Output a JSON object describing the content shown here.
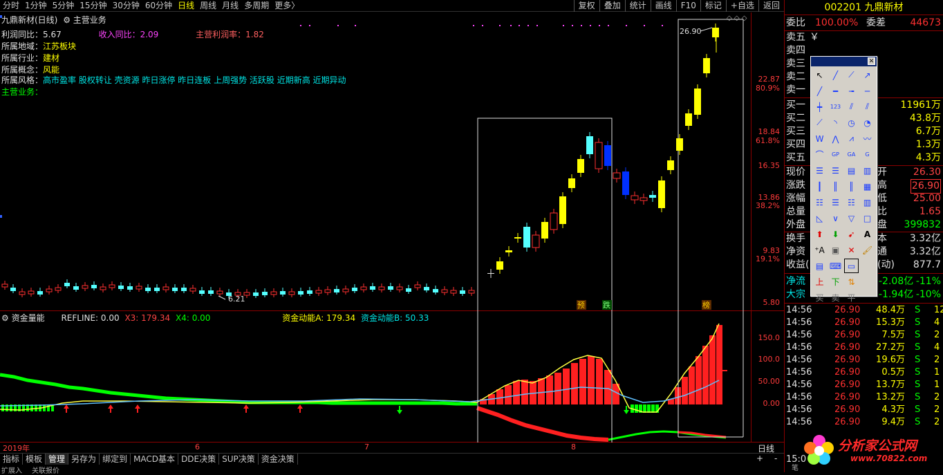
{
  "toolbar": {
    "periods": [
      "分时",
      "1分钟",
      "5分钟",
      "15分钟",
      "30分钟",
      "60分钟",
      "日线",
      "周线",
      "月线",
      "多周期",
      "更多〉"
    ],
    "active_period": "日线",
    "right_buttons": [
      "复权",
      "叠加",
      "统计",
      "画线",
      "F10",
      "标记",
      "+自选",
      "返回"
    ]
  },
  "main_chart": {
    "title": "九鼎新材(日线)",
    "indicator": "主营业务",
    "info": {
      "profit_yoy_label": "利润同比：",
      "profit_yoy": "5.67",
      "revenue_yoy_label": "收入同比：",
      "revenue_yoy": "2.09",
      "main_margin_label": "主营利润率：",
      "main_margin": "1.82",
      "region_label": "所属地域：",
      "region": "江苏板块",
      "industry_label": "所属行业：",
      "industry": "建材",
      "concept_label": "所属概念：",
      "concept": "风能",
      "style_label": "所属风格：",
      "style": "高市盈率 股权转让 壳资源 昨日涨停 昨日连板 上周强势 活跃股 近期新高 近期异动",
      "business_label": "主营业务："
    },
    "y_labels": [
      {
        "price": "22.87",
        "pct": "80.9%"
      },
      {
        "price": "18.84",
        "pct": "61.8%"
      },
      {
        "price": "16.35",
        "pct": ""
      },
      {
        "price": "13.86",
        "pct": "38.2%"
      },
      {
        "price": "9.83",
        "pct": "19.1%"
      },
      {
        "price": "5.80",
        "pct": ""
      }
    ],
    "high_label": "26.90",
    "low_label": "6.21",
    "signals": [
      "预",
      "跌",
      "榜"
    ]
  },
  "sub_chart": {
    "title": "资金量能",
    "refline_label": "REFLINE: 0.00",
    "x3_label": "X3: 179.34",
    "x4_label": "X4: 0.00",
    "a_label": "资金动能A: 179.34",
    "b_label": "资金动能B: 50.33",
    "y_labels": [
      "150.0",
      "100.0",
      "50.00",
      "0.00"
    ]
  },
  "x_axis": {
    "labels": [
      "2019年",
      "6",
      "7",
      "8"
    ],
    "right_label": "日线"
  },
  "bottom_tabs": [
    "指标",
    "模板",
    "管理",
    "另存为",
    "绑定到",
    "MACD基本",
    "DDE决策",
    "SUP决策",
    "资金决策"
  ],
  "active_tab": "管理",
  "statusbar": {
    "left": "扩展入",
    "mid": "关联报价"
  },
  "right_panel": {
    "code": "002201",
    "name": "九鼎新材",
    "weibi_label": "委比",
    "weibi": "100.00%",
    "weicha_label": "委差",
    "weicha": "44673",
    "sell_labels": [
      "卖五",
      "卖四",
      "卖三",
      "卖二",
      "卖一"
    ],
    "sell5_extra": "￥",
    "buy_labels": [
      "买一",
      "买二",
      "买三",
      "买四",
      "买五"
    ],
    "buy_vols": [
      "11961万",
      "43.8万",
      "6.7万",
      "1.3万",
      "4.3万"
    ],
    "stats": [
      {
        "l": "现价",
        "r_label": "开",
        "r_val": "26.30"
      },
      {
        "l": "涨跌",
        "r_label": "高",
        "r_val": "26.90"
      },
      {
        "l": "涨幅",
        "r_label": "低",
        "r_val": "25.00"
      },
      {
        "l": "总量",
        "r_label": "比",
        "r_val": "1.65"
      },
      {
        "l": "外盘",
        "r_label": "盘",
        "r_val": "399832"
      },
      {
        "l": "换手",
        "r_label": "本",
        "r_val": "3.32亿"
      },
      {
        "l": "净资",
        "r_label": "通",
        "r_val": "3.32亿"
      },
      {
        "l": "收益(",
        "r_label": "(动)",
        "r_val": "877.7"
      }
    ],
    "flow": [
      {
        "l": "净流",
        "v1": "-2.08亿",
        "v2": "-11%"
      },
      {
        "l": "大宗",
        "v1": "-1.94亿",
        "v2": "-10%"
      }
    ],
    "trades": [
      {
        "t": "14:56",
        "p": "26.90",
        "v": "48.4万",
        "s": "S",
        "n": "12"
      },
      {
        "t": "14:56",
        "p": "26.90",
        "v": "15.3万",
        "s": "S",
        "n": "4"
      },
      {
        "t": "14:56",
        "p": "26.90",
        "v": "7.5万",
        "s": "S",
        "n": "2"
      },
      {
        "t": "14:56",
        "p": "26.90",
        "v": "27.2万",
        "s": "S",
        "n": "4"
      },
      {
        "t": "14:56",
        "p": "26.90",
        "v": "19.6万",
        "s": "S",
        "n": "2"
      },
      {
        "t": "14:56",
        "p": "26.90",
        "v": "0.5万",
        "s": "S",
        "n": "1"
      },
      {
        "t": "14:56",
        "p": "26.90",
        "v": "13.7万",
        "s": "S",
        "n": "1"
      },
      {
        "t": "14:56",
        "p": "26.90",
        "v": "13.2万",
        "s": "S",
        "n": "2"
      },
      {
        "t": "14:56",
        "p": "26.90",
        "v": "4.3万",
        "s": "S",
        "n": "2"
      },
      {
        "t": "14:56",
        "p": "26.90",
        "v": "9.4万",
        "s": "S",
        "n": "2"
      }
    ],
    "last_trade_time": "15:0",
    "footer_label": "笔"
  },
  "palette": {
    "bottom_labels": [
      "买",
      "卖",
      "平"
    ]
  },
  "logo": {
    "text": "分析家公式网",
    "url": "www.70822.com"
  }
}
